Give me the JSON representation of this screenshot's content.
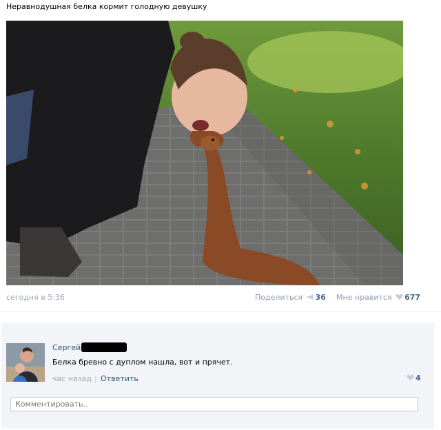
{
  "post": {
    "title": "Неравнодушная белка кормит голодную девушку",
    "date": "сегодня в 5:36",
    "share_label": "Поделиться",
    "share_count": "36",
    "like_label": "Мне нравится",
    "like_count": "677"
  },
  "comment": {
    "author": "Сергей",
    "text": "Белка бревно с дуплом нашла, вот и прячет.",
    "time": "час назад",
    "separator": "|",
    "reply_label": "Ответить",
    "like_count": "4"
  },
  "comment_box": {
    "placeholder": "Комментировать.."
  },
  "colors": {
    "link": "#2b587a",
    "meta": "#9aa7b6",
    "count": "#45688e",
    "comment_bg": "#f2f4f7"
  },
  "icons": [
    "megaphone-icon",
    "heart-icon"
  ]
}
